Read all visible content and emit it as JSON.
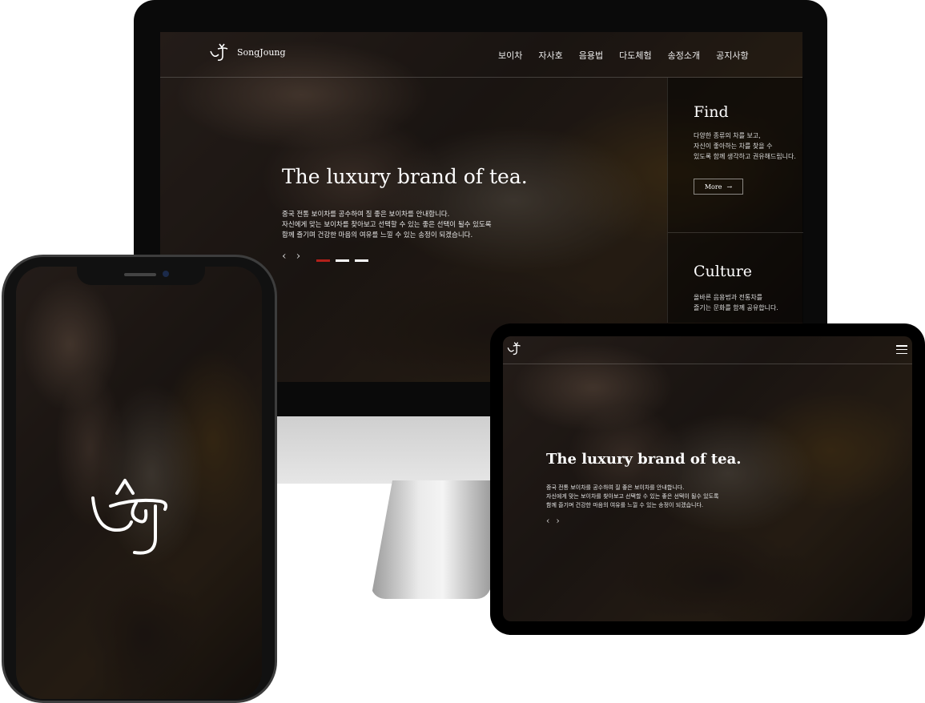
{
  "desktop": {
    "logo_text": "SongJoung",
    "menu": [
      "보이차",
      "자사호",
      "음용법",
      "다도체험",
      "송정소개",
      "공지사항"
    ],
    "hero_title": "The luxury brand of tea.",
    "hero_desc": [
      "중국 전통 보이차를 공수하여 질 좋은 보이차를 안내합니다.",
      "자신에게 맞는 보이차를 찾아보고 선택할 수 있는 좋은 선택이 될수 있도록",
      "함께 즐기며 건강한 마음의 여유를 느낄 수 있는 송정이 되겠습니다."
    ],
    "arrow_prev": "‹",
    "arrow_next": "›",
    "slide_dots": 3,
    "active_slide": 1,
    "panel": {
      "find_title": "Find",
      "find_desc": [
        "다양한 종류의 차를 보고,",
        "자신이 좋아하는 차를 찾을 수",
        "있도록 함께 생각하고 권유해드립니다."
      ],
      "more_label": "More",
      "more_arrow": "→",
      "culture_title": "Culture",
      "culture_desc": [
        "올바른 음용법과 전통차를",
        "즐기는 문화를 함께 공유합니다."
      ]
    }
  },
  "tablet": {
    "hero_title": "The luxury brand of tea.",
    "hero_desc": [
      "중국 전통 보이차를 공수하여 질 좋은 보이차를 안내합니다.",
      "자신에게 맞는 보이차를 찾아보고 선택할 수 있는 좋은 선택이 될수 있도록",
      "함께 즐기며 건강한 마음의 여유를 느낄 수 있는 송정이 되겠습니다."
    ],
    "arrow_prev": "‹",
    "arrow_next": "›",
    "menu_icon": "hamburger-icon"
  },
  "phone": {
    "logo_icon": "songjoung-logo-icon"
  },
  "colors": {
    "accent": "#b3201a",
    "text": "#ffffff",
    "device_frame": "#0a0a0a"
  }
}
